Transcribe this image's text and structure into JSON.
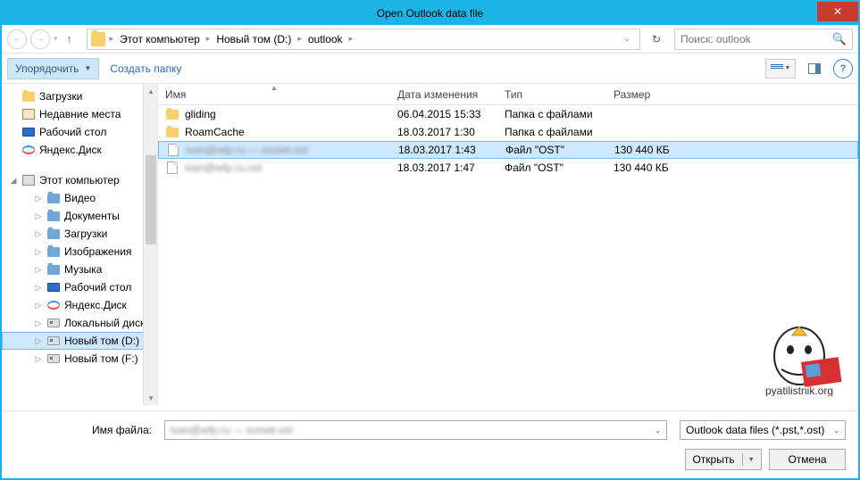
{
  "window": {
    "title": "Open Outlook data file"
  },
  "breadcrumb": {
    "root": "Этот компьютер",
    "drive": "Новый том (D:)",
    "folder": "outlook"
  },
  "search": {
    "placeholder": "Поиск: outlook"
  },
  "toolbar": {
    "organize": "Упорядочить",
    "new_folder": "Создать папку"
  },
  "sidebar": {
    "quick": [
      {
        "label": "Загрузки",
        "icon": "folder"
      },
      {
        "label": "Недавние места",
        "icon": "recent"
      },
      {
        "label": "Рабочий стол",
        "icon": "monitor"
      },
      {
        "label": "Яндекс.Диск",
        "icon": "yadisk"
      }
    ],
    "computer_label": "Этот компьютер",
    "computer": [
      {
        "label": "Видео",
        "icon": "folder-blue"
      },
      {
        "label": "Документы",
        "icon": "folder-blue"
      },
      {
        "label": "Загрузки",
        "icon": "folder-blue"
      },
      {
        "label": "Изображения",
        "icon": "folder-blue"
      },
      {
        "label": "Музыка",
        "icon": "folder-blue"
      },
      {
        "label": "Рабочий стол",
        "icon": "monitor"
      },
      {
        "label": "Яндекс.Диск",
        "icon": "yadisk"
      },
      {
        "label": "Локальный диск",
        "icon": "disk"
      },
      {
        "label": "Новый том (D:)",
        "icon": "disk",
        "selected": true
      },
      {
        "label": "Новый том (F:)",
        "icon": "disk"
      }
    ]
  },
  "columns": {
    "name": "Имя",
    "date": "Дата изменения",
    "type": "Тип",
    "size": "Размер"
  },
  "files": [
    {
      "name": "gliding",
      "date": "06.04.2015 15:33",
      "type": "Папка с файлами",
      "size": "",
      "icon": "folder"
    },
    {
      "name": "RoamCache",
      "date": "18.03.2017 1:30",
      "type": "Папка с файлами",
      "size": "",
      "icon": "folder"
    },
    {
      "name": "ivan@wfp.ru — копия.ost",
      "date": "18.03.2017 1:43",
      "type": "Файл \"OST\"",
      "size": "130 440 КБ",
      "icon": "file",
      "selected": true,
      "blur": true
    },
    {
      "name": "ivan@wfp.ru.ost",
      "date": "18.03.2017 1:47",
      "type": "Файл \"OST\"",
      "size": "130 440 КБ",
      "icon": "file",
      "blur": true
    }
  ],
  "footer": {
    "filename_label": "Имя файла:",
    "filename_value": "ivan@wfp.ru — копия.ost",
    "filetype": "Outlook data files (*.pst,*.ost)",
    "open": "Открыть",
    "cancel": "Отмена"
  },
  "watermark": "pyatilistnik.org"
}
